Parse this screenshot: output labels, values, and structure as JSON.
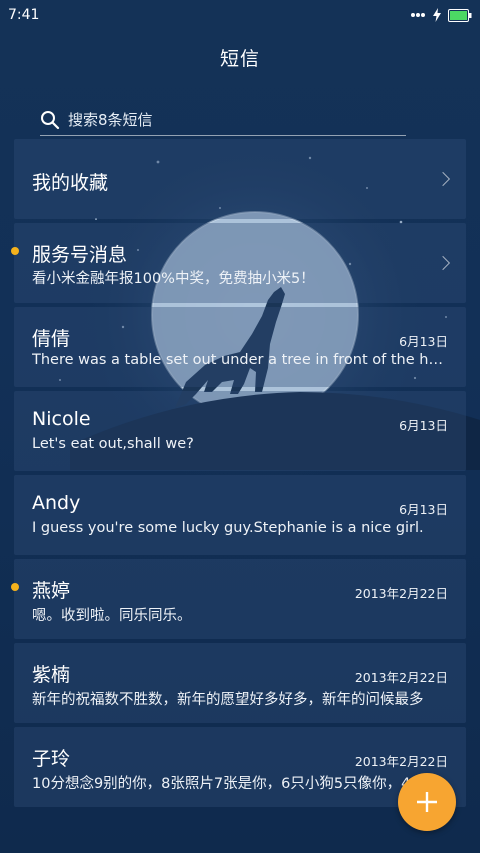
{
  "status_bar": {
    "time": "7:41"
  },
  "header": {
    "title": "短信"
  },
  "search": {
    "placeholder": "搜索8条短信"
  },
  "favorites": {
    "label": "我的收藏"
  },
  "service": {
    "name": "服务号消息",
    "preview": "看小米金融年报100%中奖，免费抽小米5！"
  },
  "conversations": [
    {
      "name": "倩倩",
      "preview": "There was a table set out under a tree in front of the house",
      "date": "6月13日",
      "unread": false
    },
    {
      "name": "Nicole",
      "preview": "Let's eat out,shall we?",
      "date": "6月13日",
      "unread": false
    },
    {
      "name": "Andy",
      "preview": "I guess you're some lucky guy.Stephanie is a nice girl.",
      "date": "6月13日",
      "unread": false
    },
    {
      "name": "燕婷",
      "preview": "嗯。收到啦。同乐同乐。",
      "date": "2013年2月22日",
      "unread": true
    },
    {
      "name": "紫楠",
      "preview": "新年的祝福数不胜数，新年的愿望好多好多，新年的问候最多",
      "date": "2013年2月22日",
      "unread": false
    },
    {
      "name": "子玲",
      "preview": "10分想念9别的你，8张照片7张是你，6只小狗5只像你，4",
      "date": "2013年2月22日",
      "unread": false
    }
  ],
  "colors": {
    "accent": "#f7a531",
    "unread_dot": "#f5b21c",
    "background": "#123057"
  },
  "icons": {
    "search": "search-icon",
    "chevron": "chevron-right-icon",
    "fab": "plus-icon"
  }
}
